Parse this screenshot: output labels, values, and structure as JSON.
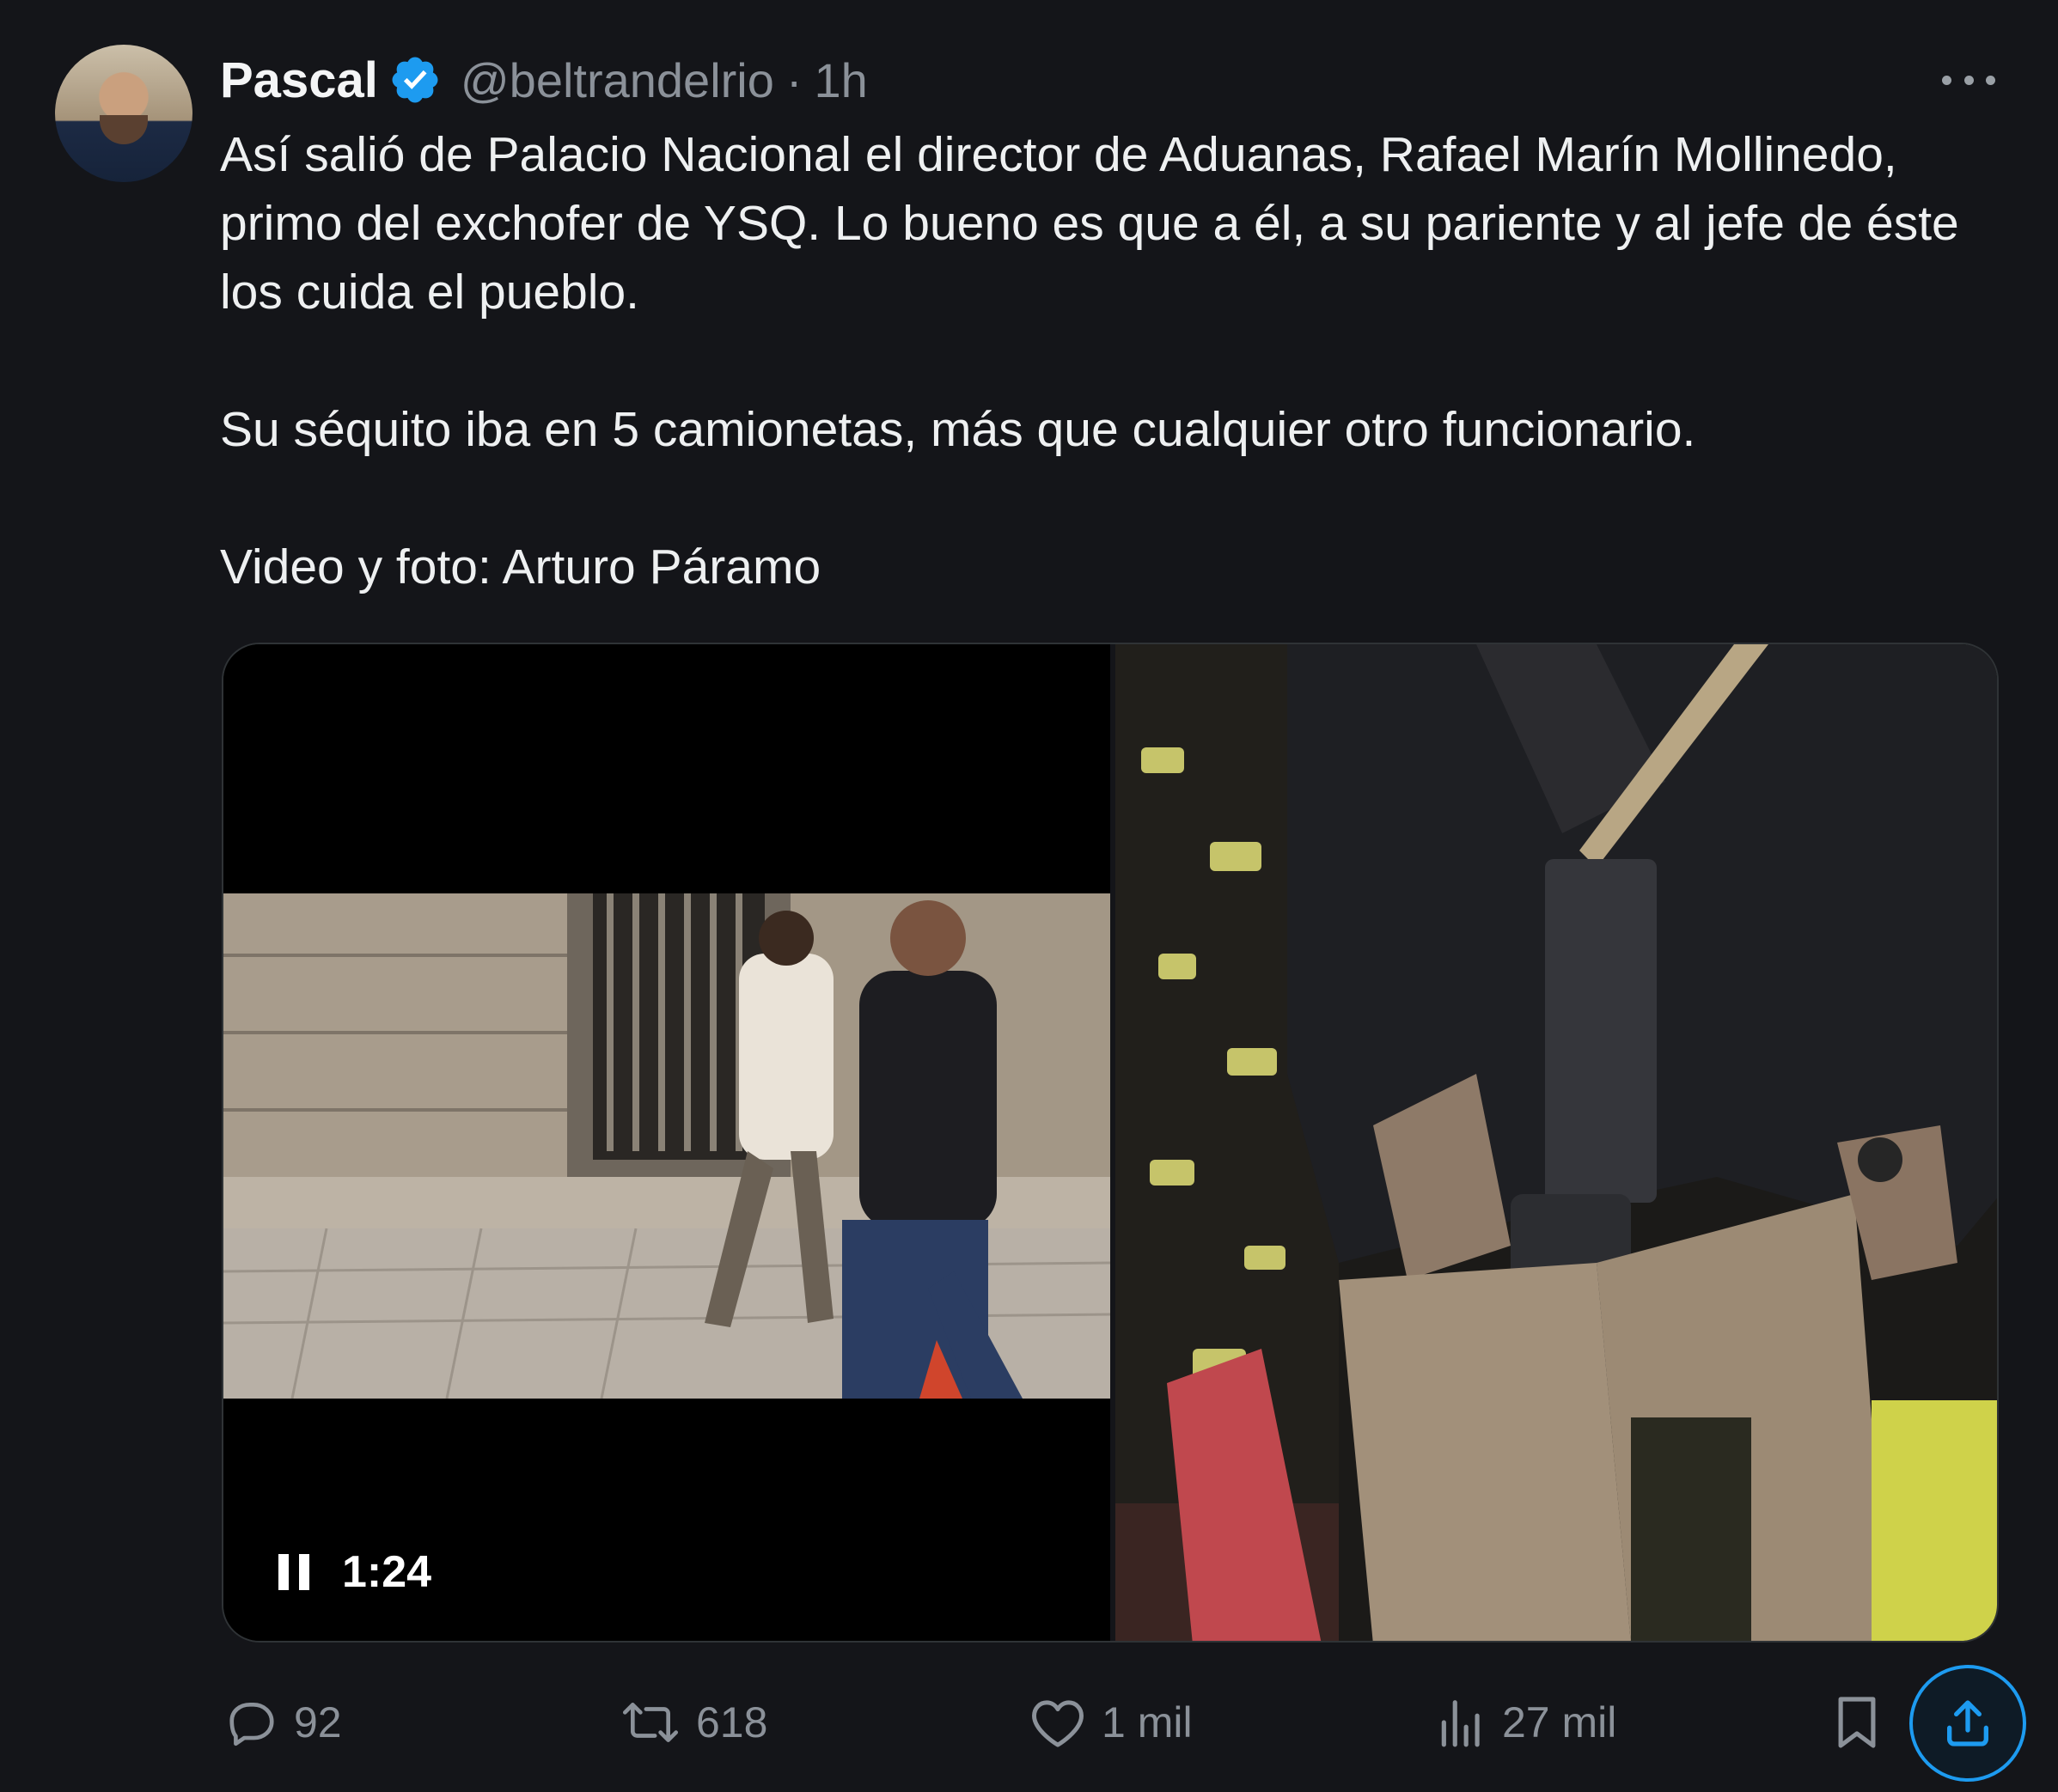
{
  "author": {
    "name": "Pascal",
    "handle": "@beltrandelrio",
    "separator": "·",
    "time": "1h",
    "verified": true
  },
  "icons": {
    "avatar": "user-photo",
    "verified": "verified-badge-icon",
    "more": "more-dots-icon",
    "reply": "reply-icon",
    "retweet": "retweet-icon",
    "like": "heart-icon",
    "views": "views-chart-icon",
    "bookmark": "bookmark-icon",
    "share": "share-icon",
    "pause": "pause-icon"
  },
  "tweet": {
    "paragraph1": "Así salió de Palacio Nacional el director de Aduanas, Rafael Marín Mollinedo, primo del exchofer de YSQ. Lo bueno es que a él, a su pariente y al jefe de éste los cuida el pueblo.",
    "paragraph2": "Su séquito iba en 5 camionetas, más que cualquier otro funcionario.",
    "paragraph3": "Video y foto: Arturo Páramo"
  },
  "media": {
    "video_duration": "1:24"
  },
  "actions": {
    "replies": "92",
    "retweets": "618",
    "likes": "1 mil",
    "views": "27 mil"
  },
  "colors": {
    "background": "#141519",
    "text": "#e7e9ea",
    "muted": "#8b9199",
    "accent": "#1d9bf0"
  }
}
